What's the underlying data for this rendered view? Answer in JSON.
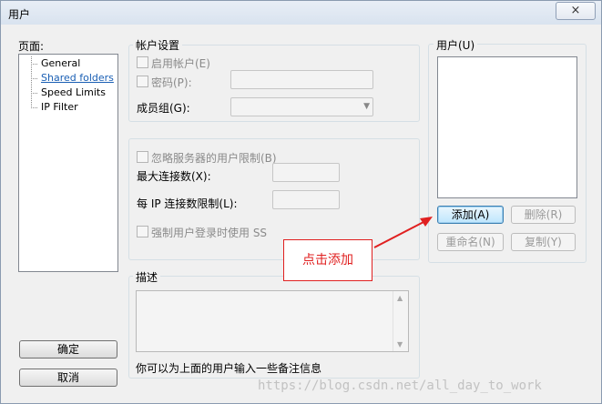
{
  "window": {
    "title": "用户",
    "close_icon": "×"
  },
  "pages": {
    "label": "页面:",
    "items": [
      "General",
      "Shared folders",
      "Speed Limits",
      "IP Filter"
    ],
    "selected": "Shared folders"
  },
  "buttons": {
    "ok": "确定",
    "cancel": "取消"
  },
  "account": {
    "group_title": "帐户设置",
    "enable_label": "启用帐户(E)",
    "password_label": "密码(P):",
    "group_label": "成员组(G):"
  },
  "limits": {
    "ignore_label": "忽略服务器的用户限制(B)",
    "max_conn_label": "最大连接数(X):",
    "per_ip_label": "每 IP 连接数限制(L):",
    "force_ssl_label": "强制用户登录时使用 SS"
  },
  "description": {
    "group_title": "描述",
    "hint": "你可以为上面的用户输入一些备注信息"
  },
  "users": {
    "group_title": "用户(U)",
    "add": "添加(A)",
    "remove": "删除(R)",
    "rename": "重命名(N)",
    "copy": "复制(Y)"
  },
  "annotation": {
    "callout": "点击添加",
    "color": "#e02020"
  },
  "watermark": "https://blog.csdn.net/all_day_to_work"
}
